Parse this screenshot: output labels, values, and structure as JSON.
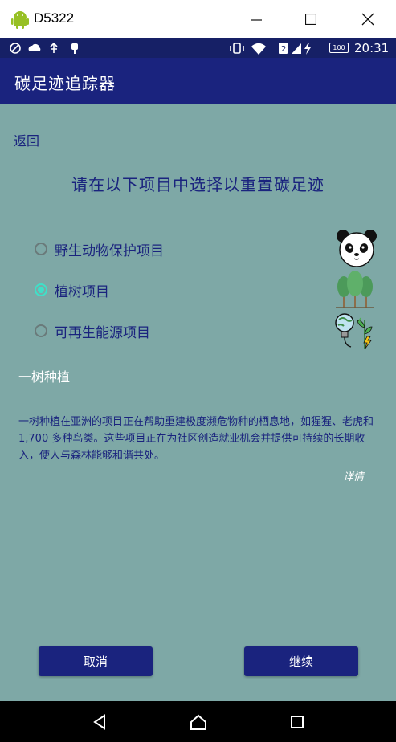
{
  "window": {
    "title": "D5322"
  },
  "statusbar": {
    "clock": "20:31",
    "battery": "100"
  },
  "app": {
    "title": "碳足迹追踪器"
  },
  "back_label": "返回",
  "heading": "请在以下项目中选择以重置碳足迹",
  "options": [
    {
      "label": "野生动物保护项目",
      "selected": false,
      "icon": "panda-icon"
    },
    {
      "label": "植树项目",
      "selected": true,
      "icon": "trees-icon"
    },
    {
      "label": "可再生能源项目",
      "selected": false,
      "icon": "renewable-energy-icon"
    }
  ],
  "section": {
    "title": "一树种植",
    "description": "一树种植在亚洲的项目正在帮助重建极度濒危物种的栖息地，如猩猩、老虎和 1,700 多种鸟类。这些项目正在为社区创造就业机会并提供可持续的长期收入，使人与森林能够和谐共处。",
    "details_link": "详情"
  },
  "buttons": {
    "cancel": "取消",
    "continue": "继续"
  },
  "colors": {
    "primary": "#1a237e",
    "background": "#7ea8a6",
    "accent": "#3fe0c8"
  }
}
